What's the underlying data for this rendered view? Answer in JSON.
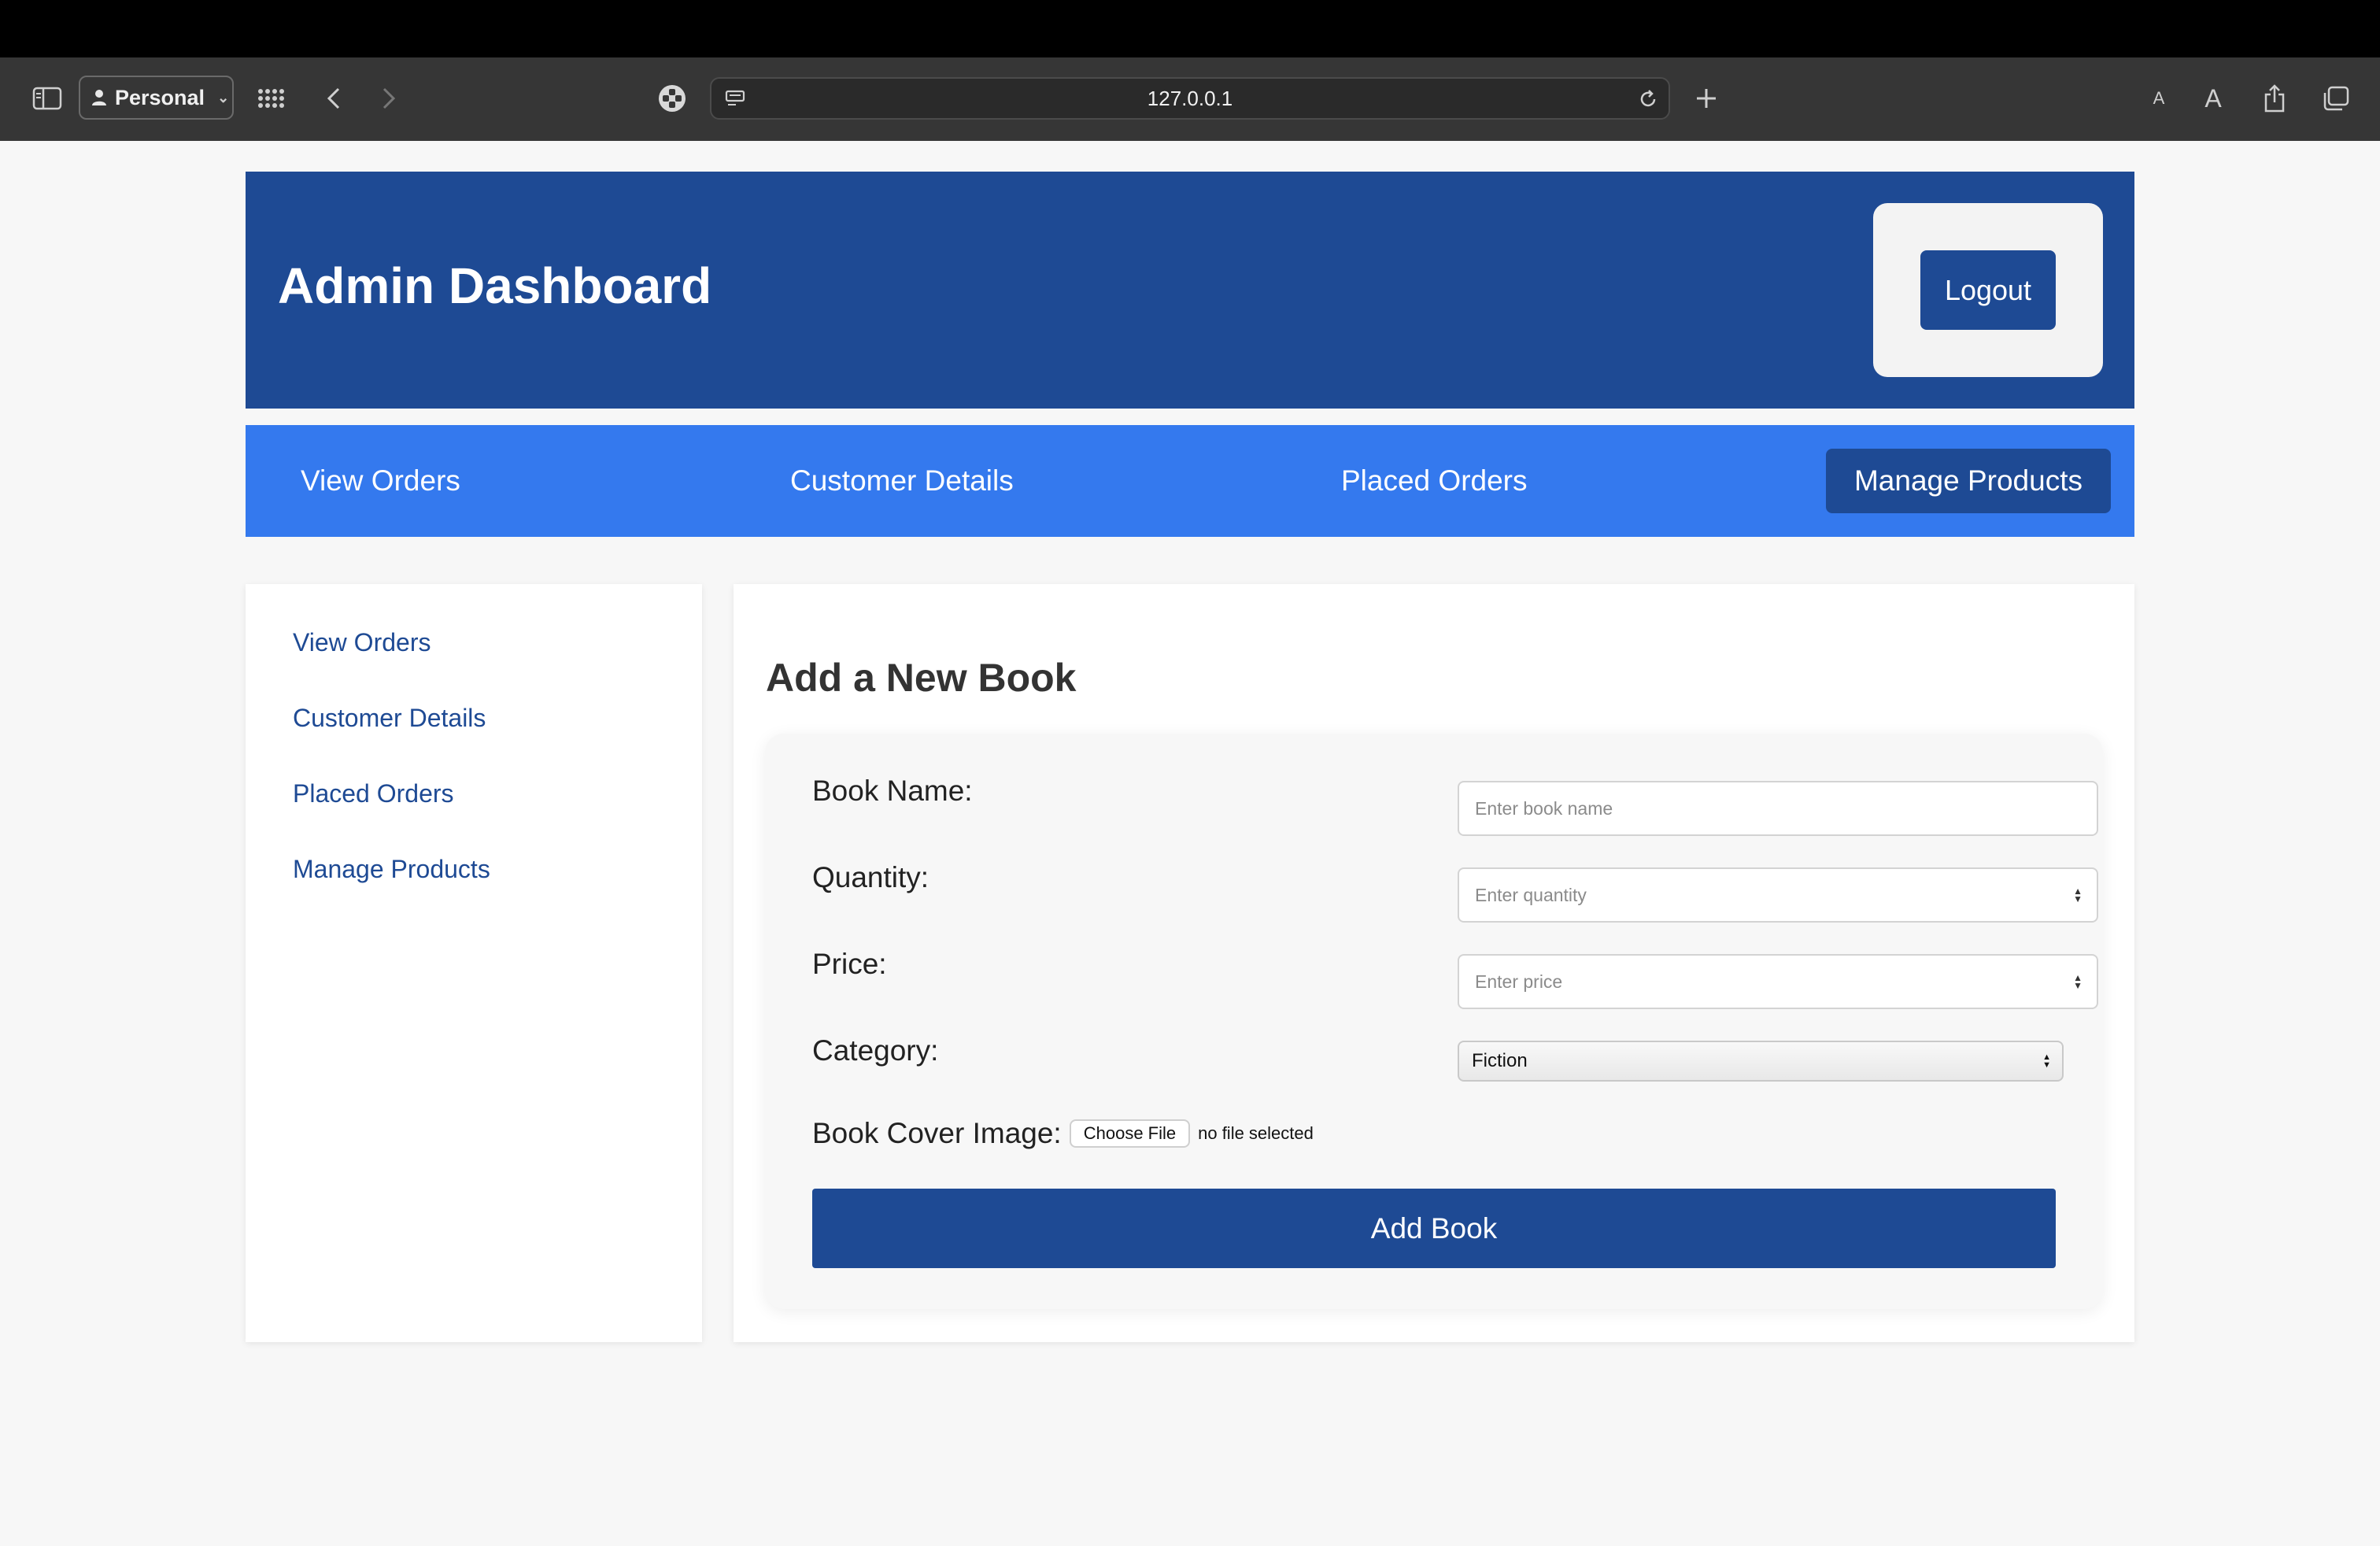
{
  "browser": {
    "profile_label": "Personal",
    "url": "127.0.0.1",
    "text_size_small": "A",
    "text_size_large": "A"
  },
  "header": {
    "title": "Admin Dashboard",
    "logout_label": "Logout"
  },
  "topnav": {
    "items": [
      "View Orders",
      "Customer Details",
      "Placed Orders"
    ],
    "active_label": "Manage Products"
  },
  "sidebar": {
    "links": [
      "View Orders",
      "Customer Details",
      "Placed Orders",
      "Manage Products"
    ]
  },
  "form": {
    "heading": "Add a New Book",
    "book_name_label": "Book Name:",
    "book_name_placeholder": "Enter book name",
    "quantity_label": "Quantity:",
    "quantity_placeholder": "Enter quantity",
    "price_label": "Price:",
    "price_placeholder": "Enter price",
    "category_label": "Category:",
    "category_value": "Fiction",
    "cover_label": "Book Cover Image:",
    "choose_file_label": "Choose File",
    "file_status": "no file selected",
    "submit_label": "Add Book"
  },
  "colors": {
    "primary": "#1e4a94",
    "nav": "#3479ee",
    "background": "#f7f7f7"
  }
}
